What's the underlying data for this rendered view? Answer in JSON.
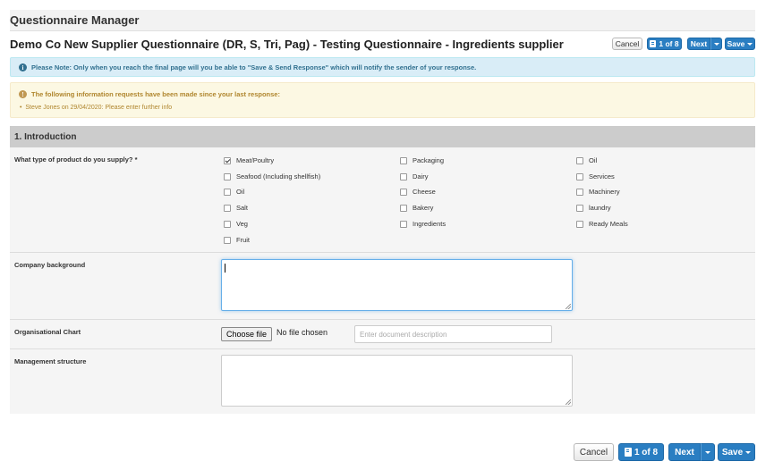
{
  "app": {
    "title": "Questionnaire Manager"
  },
  "page": {
    "title": "Demo Co New Supplier Questionnaire (DR, S, Tri, Pag) - Testing Questionnaire - Ingredients supplier"
  },
  "toolbar_top": {
    "cancel": "Cancel",
    "pager": "1 of 8",
    "next": "Next",
    "save": "Save"
  },
  "toolbar_bottom": {
    "cancel": "Cancel",
    "pager": "1 of 8",
    "next": "Next",
    "save": "Save"
  },
  "alerts": {
    "info": "Please Note: Only when you reach the final page will you be able to \"Save & Send Response\" which will notify the sender of your response.",
    "warning_heading": "The following information requests have been made since your last response:",
    "warning_items": [
      "Steve Jones on 29/04/2020: Please enter further info"
    ]
  },
  "section": {
    "title": "1. Introduction"
  },
  "questions": {
    "product_type": {
      "label": "What type of product do you supply? *",
      "options": [
        {
          "label": "Meat/Poultry",
          "checked": true
        },
        {
          "label": "Seafood (Including shellfish)",
          "checked": false
        },
        {
          "label": "Oil",
          "checked": false
        },
        {
          "label": "Salt",
          "checked": false
        },
        {
          "label": "Veg",
          "checked": false
        },
        {
          "label": "Fruit",
          "checked": false
        },
        {
          "label": "Packaging",
          "checked": false
        },
        {
          "label": "Dairy",
          "checked": false
        },
        {
          "label": "Cheese",
          "checked": false
        },
        {
          "label": "Bakery",
          "checked": false
        },
        {
          "label": "Ingredients",
          "checked": false
        },
        {
          "label": "Oil",
          "checked": false
        },
        {
          "label": "Services",
          "checked": false
        },
        {
          "label": "Machinery",
          "checked": false
        },
        {
          "label": "laundry",
          "checked": false
        },
        {
          "label": "Ready Meals",
          "checked": false
        }
      ]
    },
    "company_background": {
      "label": "Company background",
      "value": ""
    },
    "org_chart": {
      "label": "Organisational Chart",
      "file_button": "Choose file",
      "file_status": "No file chosen",
      "description_placeholder": "Enter document description"
    },
    "management_structure": {
      "label": "Management structure",
      "value": ""
    }
  },
  "colors": {
    "primary": "#2a7ec2",
    "info_bg": "#d9edf7",
    "warning_bg": "#fcf8e3",
    "section_bg": "#cccccc"
  },
  "icons": {
    "info": "info-circle-icon",
    "warning": "exclamation-circle-icon",
    "pager": "book-icon",
    "dropdown": "caret-down-icon"
  }
}
